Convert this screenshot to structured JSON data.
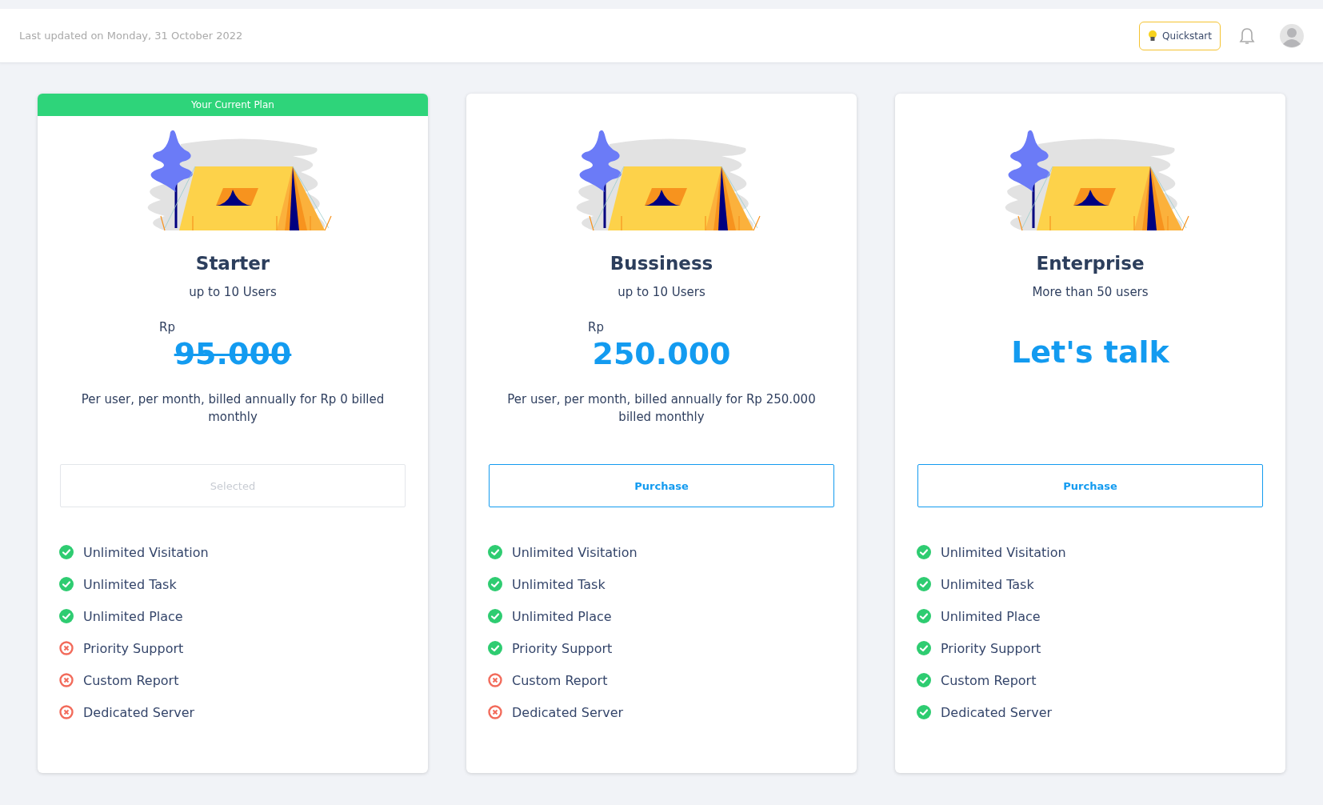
{
  "header": {
    "last_updated": "Last updated on Monday, 31 October 2022",
    "quickstart": "Quickstart"
  },
  "plans": [
    {
      "current_plan_banner": "Your Current Plan",
      "name": "Starter",
      "users": "up to 10 Users",
      "currency": "Rp",
      "price": "95.000",
      "struck": true,
      "kind": "price",
      "description": "Per user, per month, billed annually for Rp 0 billed monthly",
      "button": {
        "label": "Selected",
        "disabled": true
      },
      "features": [
        {
          "label": "Unlimited Visitation",
          "included": true
        },
        {
          "label": "Unlimited Task",
          "included": true
        },
        {
          "label": "Unlimited Place",
          "included": true
        },
        {
          "label": "Priority Support",
          "included": false
        },
        {
          "label": "Custom Report",
          "included": false
        },
        {
          "label": "Dedicated Server",
          "included": false
        }
      ]
    },
    {
      "name": "Bussiness",
      "users": "up to 10 Users",
      "currency": "Rp",
      "price": "250.000",
      "struck": false,
      "kind": "price",
      "description": "Per user, per month, billed annually for Rp 250.000 billed monthly",
      "button": {
        "label": "Purchase",
        "disabled": false
      },
      "features": [
        {
          "label": "Unlimited Visitation",
          "included": true
        },
        {
          "label": "Unlimited Task",
          "included": true
        },
        {
          "label": "Unlimited Place",
          "included": true
        },
        {
          "label": "Priority Support",
          "included": true
        },
        {
          "label": "Custom Report",
          "included": false
        },
        {
          "label": "Dedicated Server",
          "included": false
        }
      ]
    },
    {
      "name": "Enterprise",
      "users": "More than 50 users",
      "price": "Let's talk",
      "struck": false,
      "kind": "contact",
      "button": {
        "label": "Purchase",
        "disabled": false
      },
      "features": [
        {
          "label": "Unlimited Visitation",
          "included": true
        },
        {
          "label": "Unlimited Task",
          "included": true
        },
        {
          "label": "Unlimited Place",
          "included": true
        },
        {
          "label": "Priority Support",
          "included": true
        },
        {
          "label": "Custom Report",
          "included": true
        },
        {
          "label": "Dedicated Server",
          "included": true
        }
      ]
    }
  ]
}
